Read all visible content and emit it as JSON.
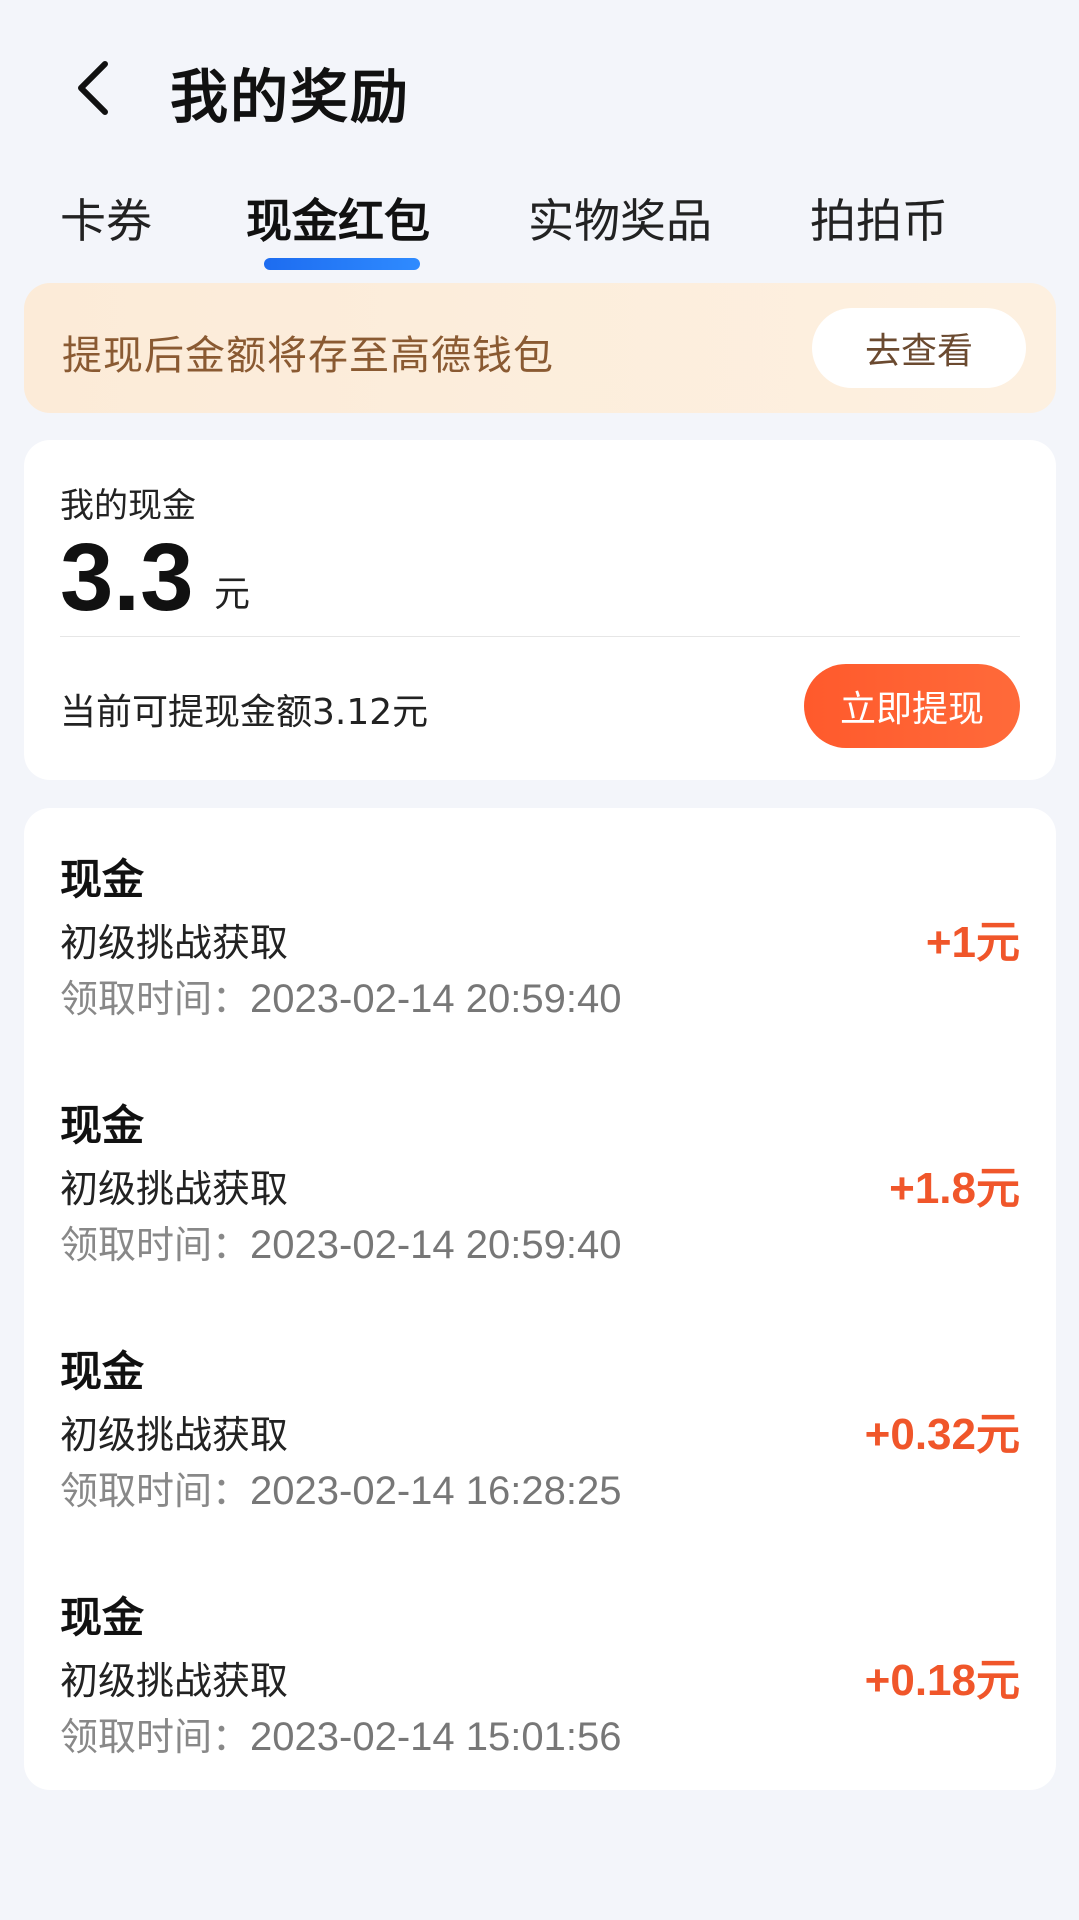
{
  "header": {
    "title": "我的奖励"
  },
  "tabs": [
    {
      "label": "卡券"
    },
    {
      "label": "现金红包"
    },
    {
      "label": "实物奖品"
    },
    {
      "label": "拍拍币"
    }
  ],
  "notice": {
    "text": "提现后金额将存至高德钱包",
    "button": "去查看"
  },
  "cash": {
    "label": "我的现金",
    "amount": "3.3",
    "unit": "元",
    "withdrawable": "当前可提现金额3.12元",
    "withdraw_button": "立即提现"
  },
  "records": [
    {
      "title": "现金",
      "source": "初级挑战获取",
      "time_label": "领取时间：",
      "time": "2023-02-14 20:59:40",
      "amount": "+1元"
    },
    {
      "title": "现金",
      "source": "初级挑战获取",
      "time_label": "领取时间：",
      "time": "2023-02-14 20:59:40",
      "amount": "+1.8元"
    },
    {
      "title": "现金",
      "source": "初级挑战获取",
      "time_label": "领取时间：",
      "time": "2023-02-14 16:28:25",
      "amount": "+0.32元"
    },
    {
      "title": "现金",
      "source": "初级挑战获取",
      "time_label": "领取时间：",
      "time": "2023-02-14 15:01:56",
      "amount": "+0.18元"
    }
  ]
}
